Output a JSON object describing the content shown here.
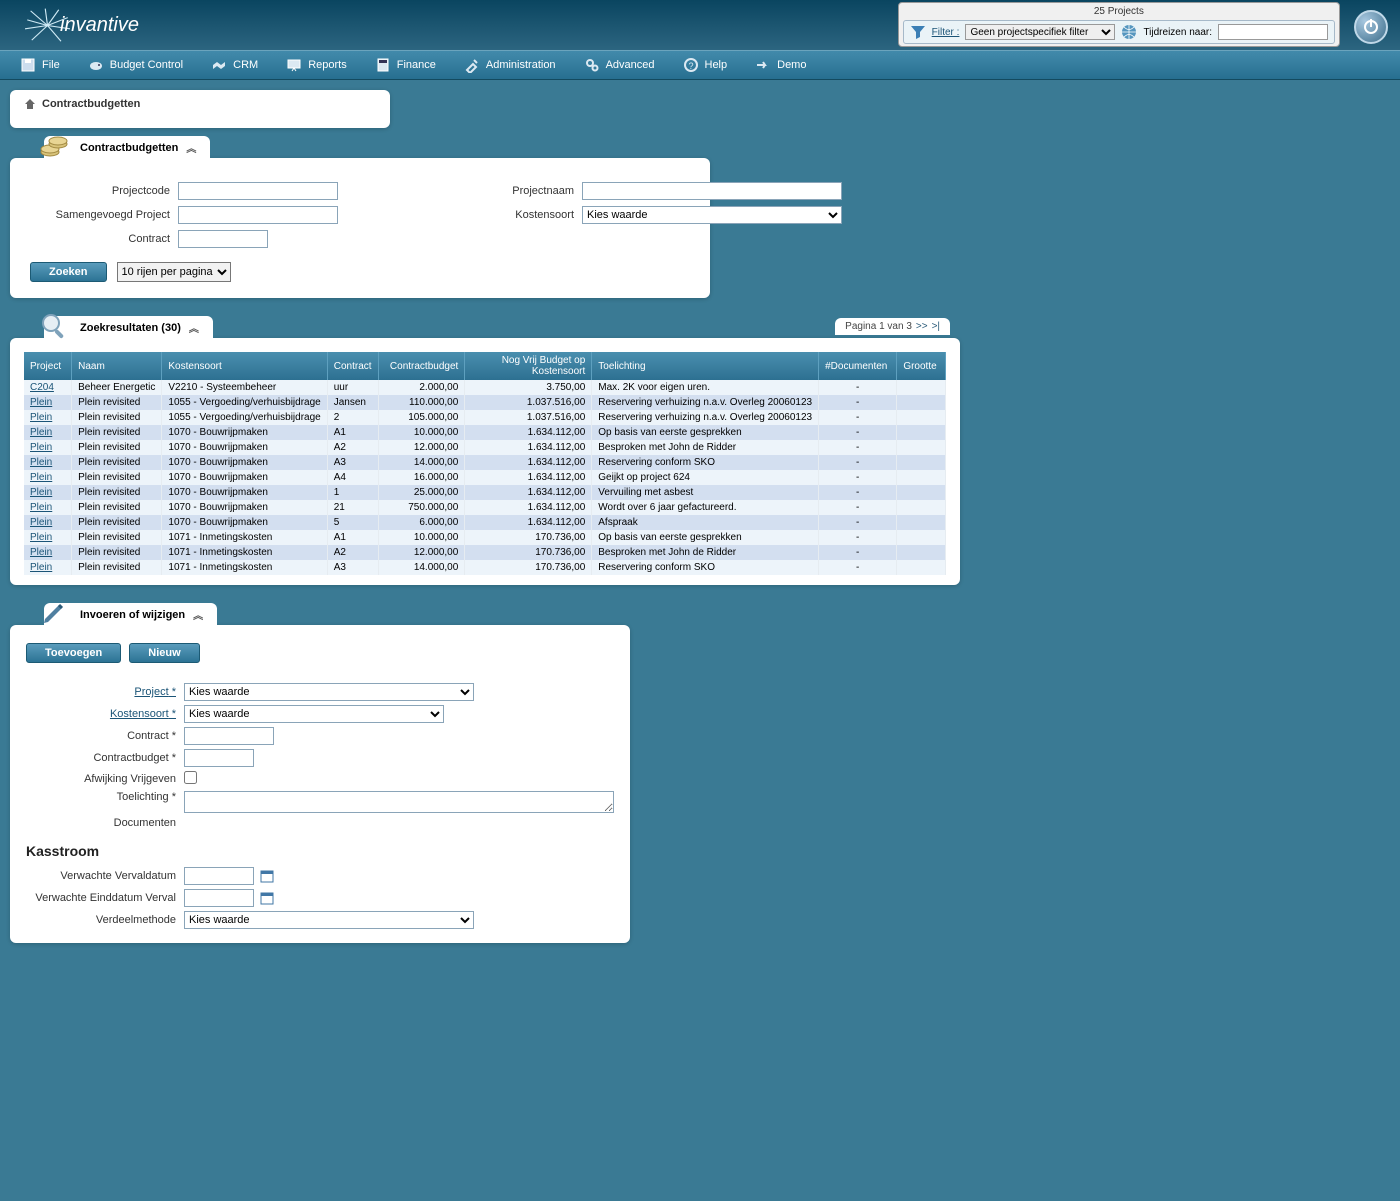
{
  "brand": "invantive",
  "top": {
    "projects_count": "25 Projects",
    "filter_label": "Filter :",
    "filter_value": "Geen projectspecifiek filter",
    "timetravel_label": "Tijdreizen naar:",
    "timetravel_value": ""
  },
  "menu": {
    "file": "File",
    "budget": "Budget Control",
    "crm": "CRM",
    "reports": "Reports",
    "finance": "Finance",
    "admin": "Administration",
    "advanced": "Advanced",
    "help": "Help",
    "demo": "Demo"
  },
  "breadcrumb": "Contractbudgetten",
  "filters": {
    "title": "Contractbudgetten",
    "projectcode": "Projectcode",
    "samengevoegd": "Samengevoegd Project",
    "contract": "Contract",
    "projectnaam": "Projectnaam",
    "kostensoort": "Kostensoort",
    "kostensoort_value": "Kies waarde",
    "zoeken": "Zoeken",
    "rows_value": "10 rijen per pagina"
  },
  "results": {
    "title": "Zoekresultaten (30)",
    "page_label": "Pagina 1 van 3",
    "next": ">>",
    "last": ">|",
    "cols": {
      "project": "Project",
      "naam": "Naam",
      "kostensoort": "Kostensoort",
      "contract": "Contract",
      "contractbudget": "Contractbudget",
      "vrij": "Nog Vrij Budget op Kostensoort",
      "toelichting": "Toelichting",
      "documenten": "#Documenten",
      "grootte": "Grootte"
    },
    "rows": [
      {
        "project": "C204",
        "link": true,
        "naam": "Beheer Energetic",
        "kostensoort": "V2210 - Systeembeheer",
        "contract": "uur",
        "contractbudget": "2.000,00",
        "vrij": "3.750,00",
        "toelichting": "Max. 2K voor eigen uren.",
        "documenten": "-",
        "grootte": ""
      },
      {
        "project": "Plein",
        "link": true,
        "naam": "Plein revisited",
        "kostensoort": "1055 - Vergoeding/verhuisbijdrage",
        "contract": "Jansen",
        "contractbudget": "110.000,00",
        "vrij": "1.037.516,00",
        "toelichting": "Reservering verhuizing n.a.v. Overleg 20060123",
        "documenten": "-",
        "grootte": ""
      },
      {
        "project": "Plein",
        "link": true,
        "naam": "Plein revisited",
        "kostensoort": "1055 - Vergoeding/verhuisbijdrage",
        "contract": "2",
        "contractbudget": "105.000,00",
        "vrij": "1.037.516,00",
        "toelichting": "Reservering verhuizing n.a.v. Overleg 20060123",
        "documenten": "-",
        "grootte": ""
      },
      {
        "project": "Plein",
        "link": true,
        "naam": "Plein revisited",
        "kostensoort": "1070 - Bouwrijpmaken",
        "contract": "A1",
        "contractbudget": "10.000,00",
        "vrij": "1.634.112,00",
        "toelichting": "Op basis van eerste gesprekken",
        "documenten": "-",
        "grootte": ""
      },
      {
        "project": "Plein",
        "link": true,
        "naam": "Plein revisited",
        "kostensoort": "1070 - Bouwrijpmaken",
        "contract": "A2",
        "contractbudget": "12.000,00",
        "vrij": "1.634.112,00",
        "toelichting": "Besproken met John de Ridder",
        "documenten": "-",
        "grootte": ""
      },
      {
        "project": "Plein",
        "link": true,
        "naam": "Plein revisited",
        "kostensoort": "1070 - Bouwrijpmaken",
        "contract": "A3",
        "contractbudget": "14.000,00",
        "vrij": "1.634.112,00",
        "toelichting": "Reservering conform SKO",
        "documenten": "-",
        "grootte": ""
      },
      {
        "project": "Plein",
        "link": true,
        "naam": "Plein revisited",
        "kostensoort": "1070 - Bouwrijpmaken",
        "contract": "A4",
        "contractbudget": "16.000,00",
        "vrij": "1.634.112,00",
        "toelichting": "Geijkt op project 624",
        "documenten": "-",
        "grootte": ""
      },
      {
        "project": "Plein",
        "link": true,
        "naam": "Plein revisited",
        "kostensoort": "1070 - Bouwrijpmaken",
        "contract": "1",
        "contractbudget": "25.000,00",
        "vrij": "1.634.112,00",
        "toelichting": "Vervuiling met asbest",
        "documenten": "-",
        "grootte": ""
      },
      {
        "project": "Plein",
        "link": true,
        "naam": "Plein revisited",
        "kostensoort": "1070 - Bouwrijpmaken",
        "contract": "21",
        "contractbudget": "750.000,00",
        "vrij": "1.634.112,00",
        "toelichting": "Wordt over 6 jaar gefactureerd.",
        "documenten": "-",
        "grootte": ""
      },
      {
        "project": "Plein",
        "link": true,
        "naam": "Plein revisited",
        "kostensoort": "1070 - Bouwrijpmaken",
        "contract": "5",
        "contractbudget": "6.000,00",
        "vrij": "1.634.112,00",
        "toelichting": "Afspraak",
        "documenten": "-",
        "grootte": ""
      },
      {
        "project": "Plein",
        "link": true,
        "naam": "Plein revisited",
        "kostensoort": "1071 - Inmetingskosten",
        "contract": "A1",
        "contractbudget": "10.000,00",
        "vrij": "170.736,00",
        "toelichting": "Op basis van eerste gesprekken",
        "documenten": "-",
        "grootte": ""
      },
      {
        "project": "Plein",
        "link": true,
        "naam": "Plein revisited",
        "kostensoort": "1071 - Inmetingskosten",
        "contract": "A2",
        "contractbudget": "12.000,00",
        "vrij": "170.736,00",
        "toelichting": "Besproken met John de Ridder",
        "documenten": "-",
        "grootte": ""
      },
      {
        "project": "Plein",
        "link": true,
        "naam": "Plein revisited",
        "kostensoort": "1071 - Inmetingskosten",
        "contract": "A3",
        "contractbudget": "14.000,00",
        "vrij": "170.736,00",
        "toelichting": "Reservering conform SKO",
        "documenten": "-",
        "grootte": ""
      }
    ]
  },
  "edit": {
    "title": "Invoeren of wijzigen",
    "toevoegen": "Toevoegen",
    "nieuw": "Nieuw",
    "project": "Project",
    "project_value": "Kies waarde",
    "kostensoort": "Kostensoort",
    "kostensoort_value": "Kies waarde",
    "contract": "Contract",
    "contractbudget": "Contractbudget",
    "afwijking": "Afwijking Vrijgeven",
    "toelichting": "Toelichting",
    "documenten": "Documenten",
    "kasstroom": "Kasstroom",
    "vervaldatum": "Verwachte Vervaldatum",
    "einddatum": "Verwachte Einddatum Verval",
    "verdeel": "Verdeelmethode",
    "verdeel_value": "Kies waarde"
  }
}
